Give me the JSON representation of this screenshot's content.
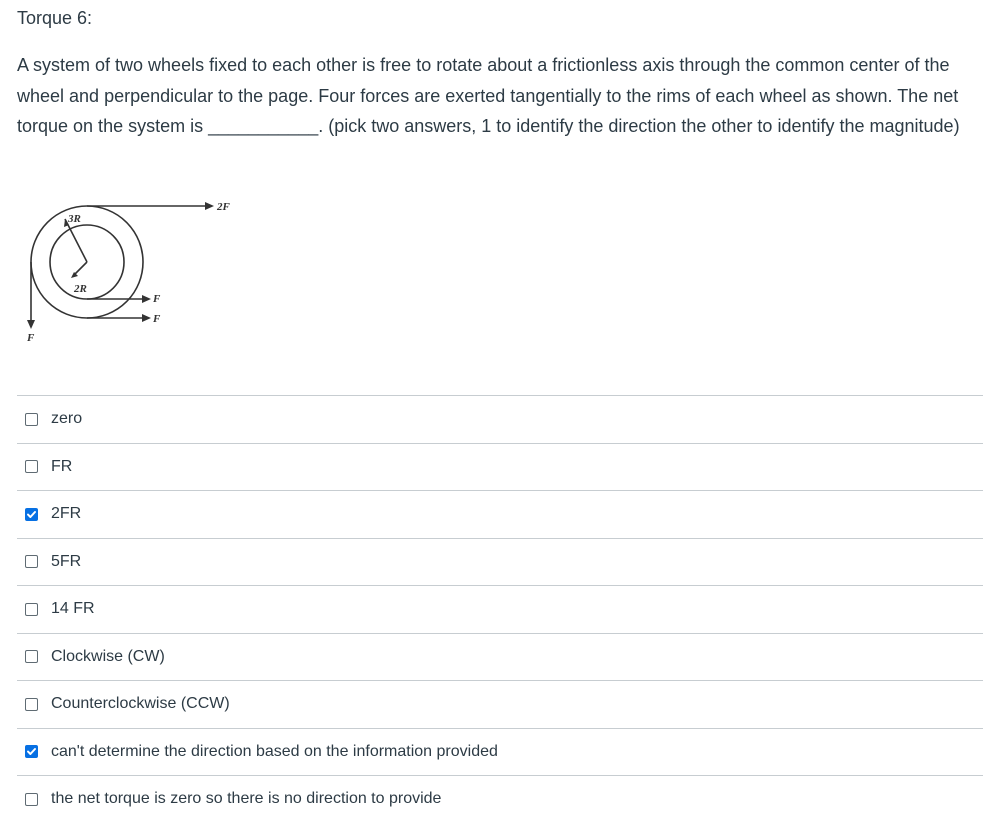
{
  "question": {
    "title": "Torque 6:",
    "text_before_blank": "A system of two wheels fixed to each other is free to rotate about a frictionless axis through the common center of the wheel and perpendicular to the page. Four forces are exerted tangentially to the rims of each wheel as shown. The  net torque on the system is ",
    "blank": "___________",
    "text_after_blank": ". (pick two answers, 1 to identify the direction the other to identify the magnitude)"
  },
  "diagram": {
    "label_outer_radius": "3R",
    "label_inner_radius": "2R",
    "label_top_force": "2F",
    "label_right_force_1": "F",
    "label_right_force_2": "F",
    "label_left_force": "F"
  },
  "answers": [
    {
      "label": "zero",
      "checked": false
    },
    {
      "label": "FR",
      "checked": false
    },
    {
      "label": "2FR",
      "checked": true
    },
    {
      "label": "5FR",
      "checked": false
    },
    {
      "label": "14 FR",
      "checked": false
    },
    {
      "label": "Clockwise (CW)",
      "checked": false
    },
    {
      "label": "Counterclockwise (CCW)",
      "checked": false
    },
    {
      "label": "can't determine the direction based on the information provided",
      "checked": true
    },
    {
      "label": "the net torque is zero so there is no direction to provide",
      "checked": false
    }
  ],
  "colors": {
    "text": "#2d3b45",
    "checkbox_checked": "#0770e3",
    "divider": "#c7cdd1"
  }
}
